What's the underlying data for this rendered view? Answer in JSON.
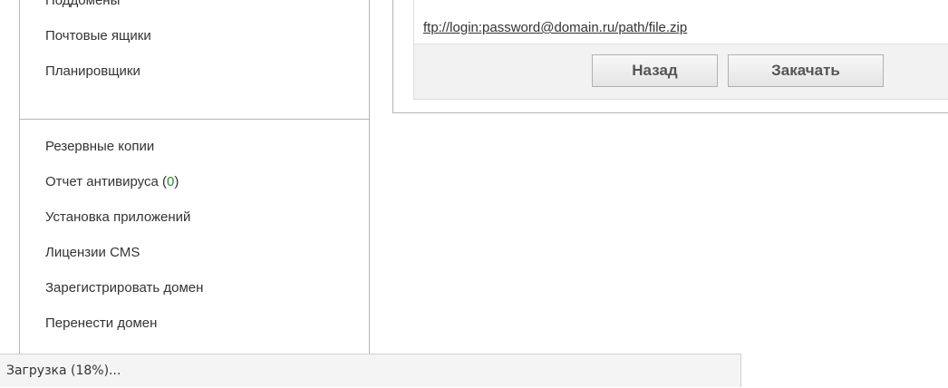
{
  "sidebar": {
    "top_items": [
      {
        "label": "Поддомены"
      },
      {
        "label": "Почтовые ящики"
      },
      {
        "label": "Планировщики"
      }
    ],
    "bottom_items": [
      {
        "label": "Резервные копии"
      },
      {
        "label": "Отчет антивируса",
        "count_open": " (",
        "count": "0",
        "count_close": ")"
      },
      {
        "label": "Установка приложений"
      },
      {
        "label": "Лицензии CMS"
      },
      {
        "label": "Зарегистрировать домен"
      },
      {
        "label": "Перенести домен"
      }
    ]
  },
  "content": {
    "example_url": "ftp://login:password@domain.ru/path/file.zip",
    "back_label": "Назад",
    "upload_label": "Закачать"
  },
  "status": {
    "text": "Загрузка (18%)..."
  },
  "colors": {
    "count_accent": "#2a8a2a",
    "border": "#b4b4b4",
    "button_bar_bg": "#f2f2f2"
  }
}
